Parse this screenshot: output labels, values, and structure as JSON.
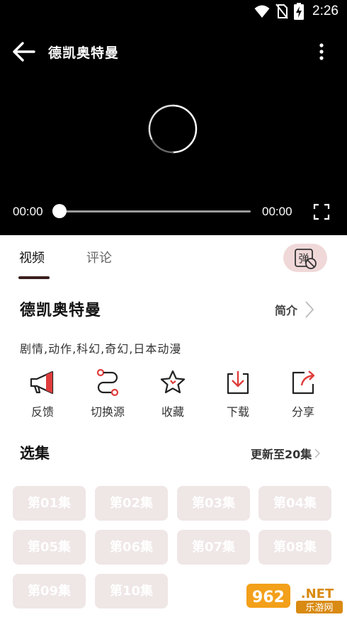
{
  "status_bar": {
    "time": "2:26",
    "icons": [
      "wifi-icon",
      "no-sim-icon",
      "battery-charging-icon"
    ]
  },
  "player": {
    "title": "德凯奥特曼",
    "current_time": "00:00",
    "total_time": "00:00",
    "progress": 0,
    "loading": true
  },
  "tabs": [
    {
      "label": "视频",
      "active": true
    },
    {
      "label": "评论",
      "active": false
    }
  ],
  "danmaku_toggle": {
    "label": "弹",
    "enabled": false
  },
  "info": {
    "title": "德凯奥特曼",
    "intro_label": "简介",
    "genres": "剧情,动作,科幻,奇幻,日本动漫"
  },
  "actions": [
    {
      "label": "反馈",
      "icon": "megaphone-icon"
    },
    {
      "label": "切换源",
      "icon": "switch-source-icon"
    },
    {
      "label": "收藏",
      "icon": "star-icon"
    },
    {
      "label": "下载",
      "icon": "download-icon"
    },
    {
      "label": "分享",
      "icon": "share-icon"
    }
  ],
  "episodes": {
    "title": "选集",
    "update_label": "更新至20集",
    "items": [
      "第01集",
      "第02集",
      "第03集",
      "第04集",
      "第05集",
      "第06集",
      "第07集",
      "第08集",
      "第09集",
      "第10集"
    ]
  },
  "watermark": {
    "text": "962.NET",
    "subtext": "乐游网"
  },
  "colors": {
    "accent": "#e03c3c",
    "episode_bg": "#efe6e6",
    "danmaku_bg": "#f0d8d8",
    "tab_underline": "#3a1e1e"
  }
}
